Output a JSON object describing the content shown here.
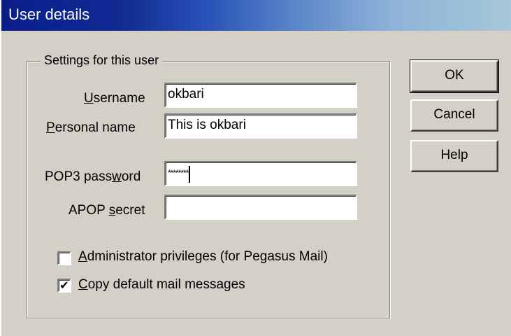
{
  "window": {
    "title": "User details"
  },
  "group": {
    "legend": "Settings for this user"
  },
  "fields": {
    "username": {
      "label_underlined": "U",
      "label_rest": "sername",
      "value": "okbari"
    },
    "personal_name": {
      "label_underlined": "P",
      "label_rest": "ersonal name",
      "value": "This is okbari"
    },
    "pop3_password": {
      "label_before": "POP3 pass",
      "label_underlined": "w",
      "label_after": "ord",
      "value": "********"
    },
    "apop_secret": {
      "label_before": "APOP ",
      "label_underlined": "s",
      "label_after": "ecret",
      "value": ""
    }
  },
  "checkboxes": {
    "admin": {
      "checked": false,
      "mark": "",
      "label_underlined": "A",
      "label_rest": "dministrator privileges (for Pegasus Mail)"
    },
    "copy_default": {
      "checked": true,
      "mark": "✔",
      "label_underlined": "C",
      "label_rest": "opy default mail messages"
    }
  },
  "buttons": {
    "ok": "OK",
    "cancel": "Cancel",
    "help": "Help"
  }
}
